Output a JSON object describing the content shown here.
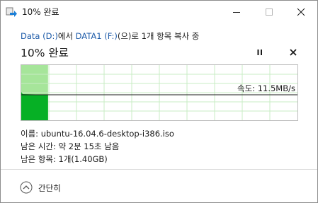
{
  "window": {
    "title": "10% 완료",
    "icon": "copy-arrow-icon",
    "accent_color": "#1c5aa8"
  },
  "header": {
    "source_link": "Data (D:)",
    "between_text": "에서 ",
    "dest_link": "DATA1 (F:)",
    "tail_text": "(으)로 1개 항목 복사 중",
    "percent_heading": "10% 완료"
  },
  "graph": {
    "progress_percent": 10,
    "speed_label": "속도: 11.5MB/s",
    "fill_color": "#06b025",
    "light_fill_color": "#a6e59a"
  },
  "details": {
    "name_label": "이름:",
    "name_value": "ubuntu-16.04.6-desktop-i386.iso",
    "time_label": "남은 시간:",
    "time_value": "약 2분 15초 남음",
    "items_label": "남은 항목:",
    "items_value": "1개(1.40GB)"
  },
  "footer": {
    "collapse_label": "간단히"
  }
}
